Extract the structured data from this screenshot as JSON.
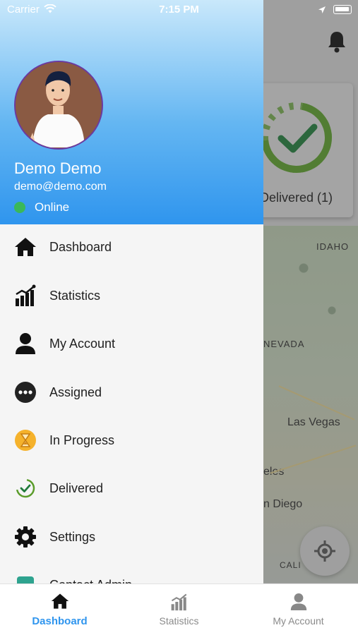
{
  "status_bar": {
    "carrier": "Carrier",
    "time": "7:15 PM"
  },
  "background": {
    "delivered_card_label": "Delivered (1)",
    "map_labels": [
      "IDAHO",
      "NEVADA",
      "Las Vegas",
      "eles",
      "n Diego",
      "CALI"
    ]
  },
  "drawer": {
    "user": {
      "name": "Demo Demo",
      "email": "demo@demo.com",
      "status": "Online"
    },
    "menu": [
      {
        "label": "Dashboard",
        "icon": "home-icon"
      },
      {
        "label": "Statistics",
        "icon": "statistics-icon"
      },
      {
        "label": "My Account",
        "icon": "user-icon"
      },
      {
        "label": "Assigned",
        "icon": "more-dots-icon"
      },
      {
        "label": "In Progress",
        "icon": "hourglass-icon"
      },
      {
        "label": "Delivered",
        "icon": "delivered-check-icon"
      },
      {
        "label": "Settings",
        "icon": "gear-icon"
      },
      {
        "label": "Contact Admin",
        "icon": "chat-icon"
      }
    ]
  },
  "tabs": [
    {
      "label": "Dashboard",
      "active": true
    },
    {
      "label": "Statistics",
      "active": false
    },
    {
      "label": "My Account",
      "active": false
    }
  ],
  "colors": {
    "accent": "#2f95ee",
    "online": "#3ab85a",
    "delivered_green": "#5a9c2a"
  }
}
